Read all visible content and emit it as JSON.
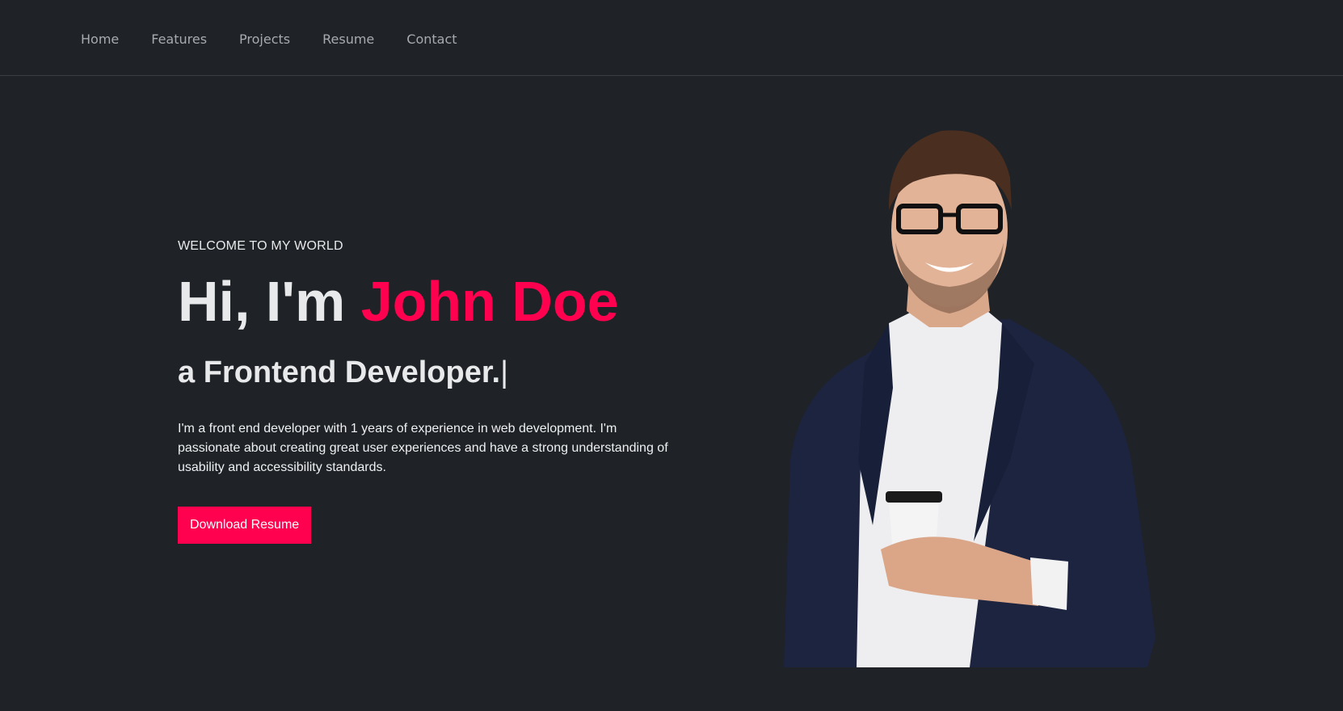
{
  "nav": {
    "items": [
      {
        "label": "Home"
      },
      {
        "label": "Features"
      },
      {
        "label": "Projects"
      },
      {
        "label": "Resume"
      },
      {
        "label": "Contact"
      }
    ]
  },
  "hero": {
    "eyebrow": "WELCOME TO MY WORLD",
    "greeting": "Hi, I'm ",
    "name": "John Doe",
    "role": "a Frontend Developer.",
    "cursor": "|",
    "bio": "I'm a front end developer with 1 years of experience in web development. I'm passionate about creating great user experiences and have a strong understanding of usability and accessibility standards.",
    "cta_label": "Download Resume"
  },
  "colors": {
    "background": "#1f2226",
    "accent": "#ff014f",
    "text": "#e8e9ea",
    "nav_text": "#a7abb0"
  }
}
